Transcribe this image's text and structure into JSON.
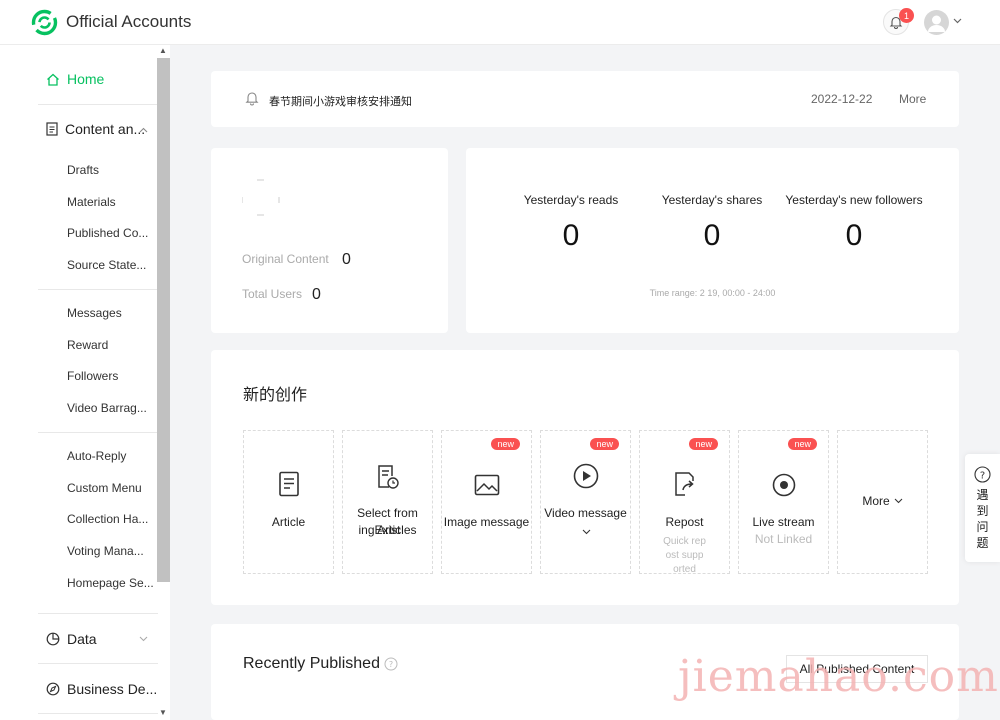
{
  "header": {
    "title": "Official Accounts",
    "notification_count": "1"
  },
  "sidebar": {
    "home": "Home",
    "content_section": "Content an...",
    "content_items": [
      "Drafts",
      "Materials",
      "Published Co...",
      "Source State..."
    ],
    "interaction_items": [
      "Messages",
      "Reward",
      "Followers",
      "Video Barrag..."
    ],
    "feature_items": [
      "Auto-Reply",
      "Custom Menu",
      "Collection Ha...",
      "Voting Mana...",
      "Homepage Se..."
    ],
    "data_section": "Data",
    "business_section": "Business De..."
  },
  "notice": {
    "text": "春节期间小游戏审核安排通知",
    "date": "2022-12-22",
    "more": "More"
  },
  "account_stats": {
    "original_content_label": "Original Content",
    "original_content_value": "0",
    "total_users_label": "Total Users",
    "total_users_value": "0"
  },
  "yesterday": {
    "reads_label": "Yesterday's reads",
    "reads_value": "0",
    "shares_label": "Yesterday's shares",
    "shares_value": "0",
    "followers_label": "Yesterday's new followers",
    "followers_value": "0",
    "time_range": "Time range: 2 19, 00:00 - 24:00"
  },
  "create": {
    "title": "新的创作",
    "tiles": {
      "article": "Article",
      "select_line1": "Select from Exist",
      "select_line2": "ing Articles",
      "image": "Image message",
      "video": "Video message",
      "repost": "Repost",
      "repost_sub1": "Quick rep",
      "repost_sub2": "ost supp",
      "repost_sub3": "orted",
      "live": "Live stream",
      "live_sub": "Not Linked",
      "more": "More",
      "new_badge": "new"
    }
  },
  "recent": {
    "title": "Recently Published",
    "all_button": "All Published Content"
  },
  "help": {
    "chars": [
      "遇",
      "到",
      "问",
      "题"
    ]
  },
  "watermark": "jiemahao.com",
  "colors": {
    "accent": "#07c160",
    "badge": "#fa5151"
  }
}
